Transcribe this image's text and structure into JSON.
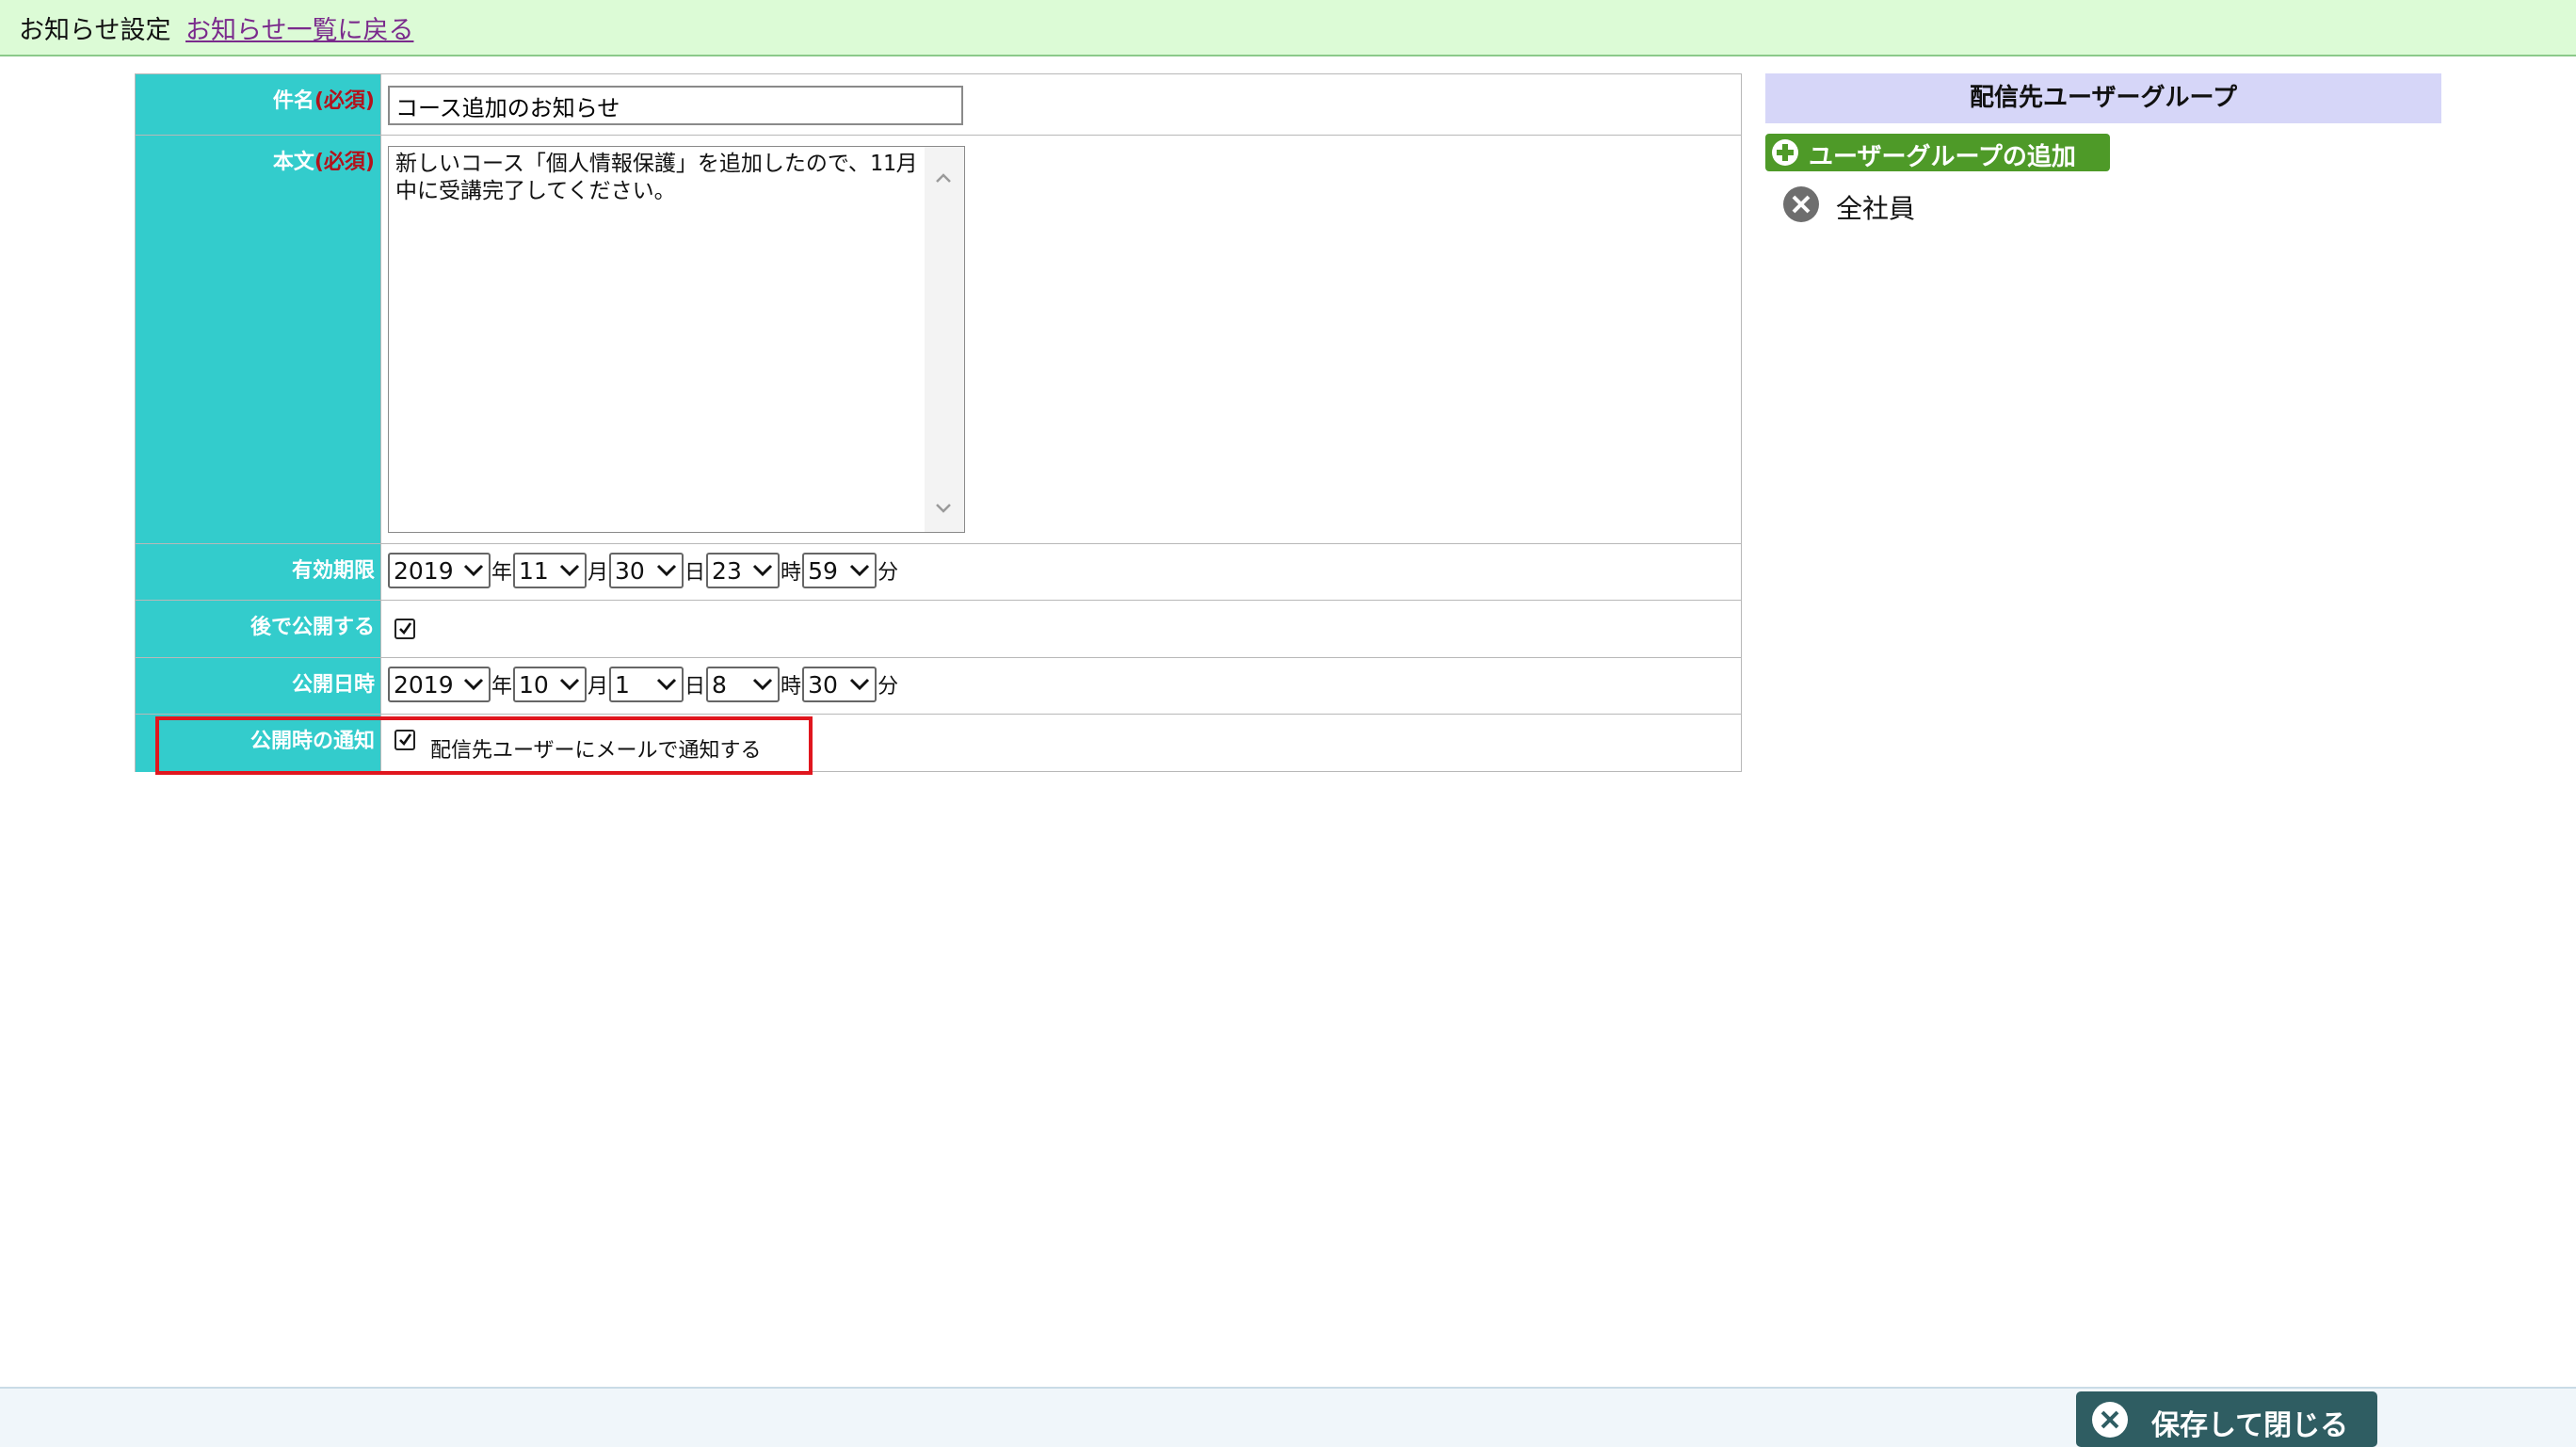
{
  "header": {
    "title": "お知らせ設定",
    "back_link": "お知らせ一覧に戻る"
  },
  "form": {
    "subject": {
      "label": "件名",
      "required": "(必須)",
      "value": "コース追加のお知らせ"
    },
    "body": {
      "label": "本文",
      "required": "(必須)",
      "value": "新しいコース「個人情報保護」を追加したので、11月中に受講完了してください。"
    },
    "expiry": {
      "label": "有効期限",
      "year": "2019",
      "month": "11",
      "day": "30",
      "hour": "23",
      "minute": "59"
    },
    "publish_later": {
      "label": "後で公開する",
      "checked": true
    },
    "publish_datetime": {
      "label": "公開日時",
      "year": "2019",
      "month": "10",
      "day": "1",
      "hour": "8",
      "minute": "30"
    },
    "notification": {
      "label": "公開時の通知",
      "checked": true,
      "text": "配信先ユーザーにメールで通知する"
    },
    "units": {
      "year": "年",
      "month": "月",
      "day": "日",
      "hour": "時",
      "minute": "分"
    }
  },
  "groups": {
    "title": "配信先ユーザーグループ",
    "add_button": "ユーザーグループの追加",
    "items": [
      {
        "name": "全社員"
      }
    ]
  },
  "footer": {
    "save_button": "保存して閉じる"
  },
  "colors": {
    "label_bg": "#33cccc",
    "header_bg": "#dcfbd6",
    "highlight": "#e0161e",
    "add_button": "#4e9a28",
    "save_button": "#2f5d62"
  },
  "icons": {
    "add": "plus-circle-icon",
    "remove": "close-circle-icon",
    "dropdown": "chevron-down-icon",
    "save": "close-circle-icon"
  }
}
